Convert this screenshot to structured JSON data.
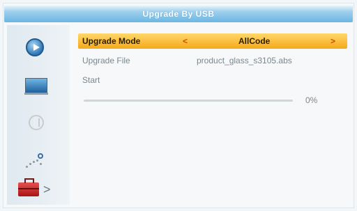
{
  "window": {
    "title": "Upgrade By USB"
  },
  "sidebar": {
    "icons": [
      "play-icon",
      "tv-icon",
      "globe-icon",
      "tools-icon",
      "toolbox-icon"
    ],
    "selected_arrow": ">"
  },
  "menu": {
    "upgrade_mode": {
      "label": "Upgrade Mode",
      "value": "AllCode",
      "left_chevron": "<",
      "right_chevron": ">"
    },
    "upgrade_file": {
      "label": "Upgrade File",
      "value": "product_glass_s3105.abs"
    },
    "start": {
      "label": "Start"
    }
  },
  "progress": {
    "percent_text": "0%",
    "value": 0
  },
  "colors": {
    "accent": "#f5a81a",
    "title_bar": "#6bb6e3"
  }
}
